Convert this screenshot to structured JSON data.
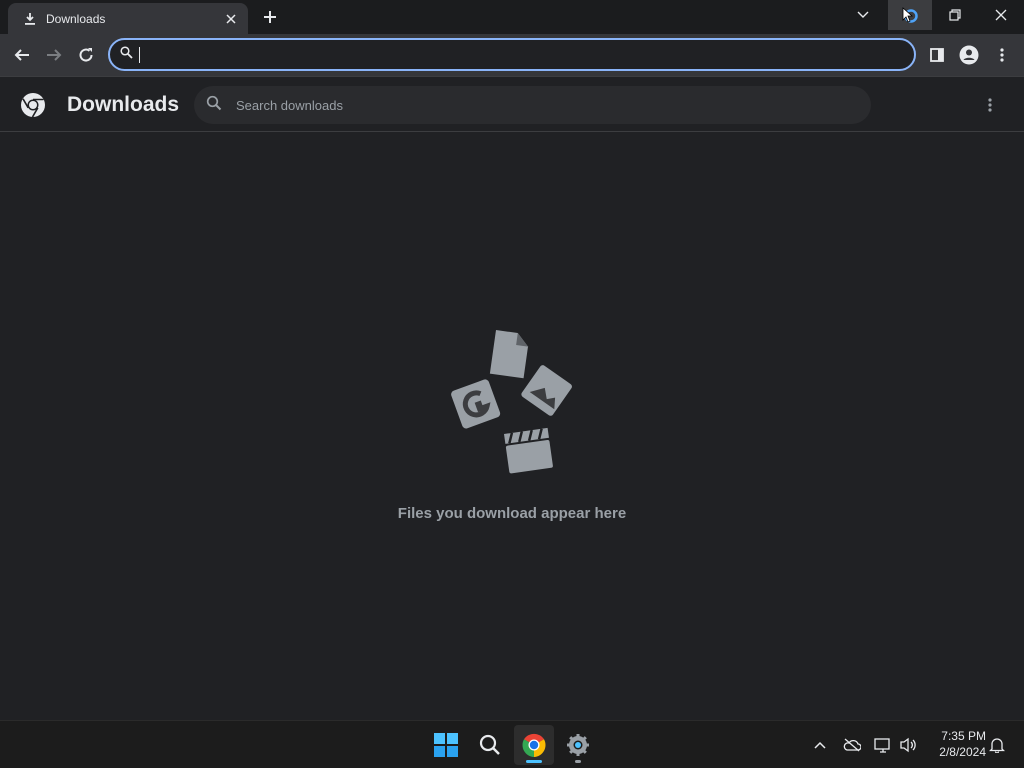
{
  "tab": {
    "title": "Downloads",
    "icon": "download-icon",
    "close_icon": "close-icon"
  },
  "toolbar": {
    "omnibox_value": "",
    "omnibox_placeholder": ""
  },
  "page": {
    "title": "Downloads",
    "search_placeholder": "Search downloads",
    "empty_message": "Files you download appear here"
  },
  "taskbar": {
    "apps": [
      "windows-start",
      "search",
      "chrome",
      "settings"
    ],
    "time": "7:35 PM",
    "date": "2/8/2024"
  },
  "colors": {
    "accent": "#8ab4f8",
    "background": "#202124",
    "toolbar": "#35363a",
    "taskbar": "#1c1c1c"
  }
}
